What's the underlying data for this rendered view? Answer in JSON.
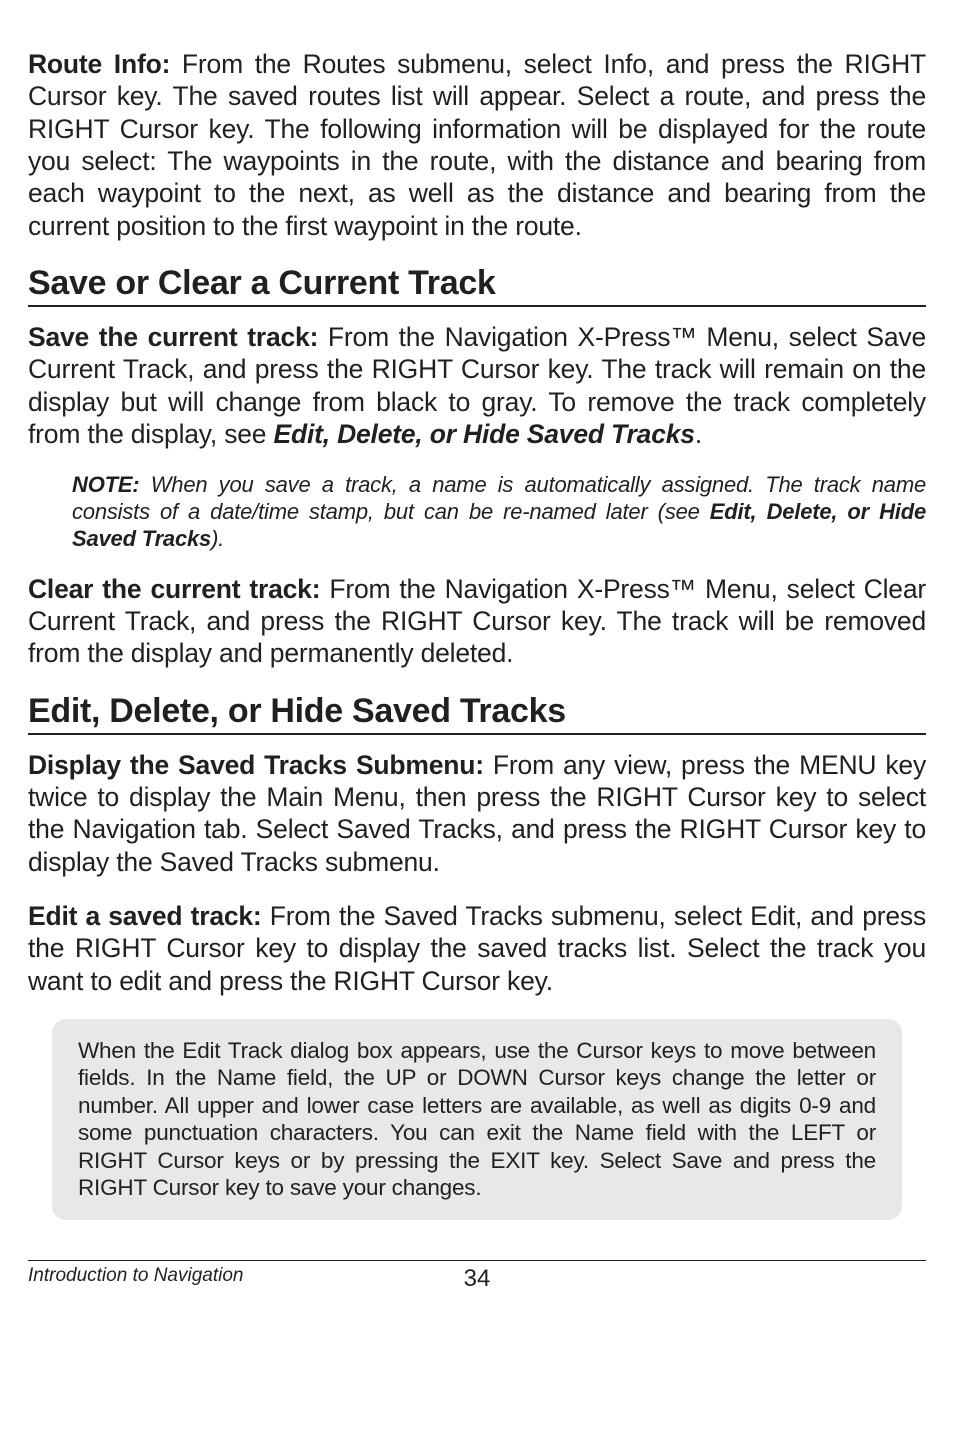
{
  "para1": {
    "lead": "Route Info:",
    "text": " From the Routes submenu, select Info, and press the RIGHT Cursor key. The saved routes list will appear. Select a route, and press the RIGHT Cursor key. The following information will be displayed for the route you select: The  waypoints in the route, with the distance and bearing from each waypoint to the next, as well as the distance and bearing from the current position to the first waypoint in the route."
  },
  "heading1": "Save or Clear a Current Track",
  "para2": {
    "lead": "Save the current track:",
    "text1": " From the Navigation X-Press™ Menu, select Save Current Track, and press the RIGHT Cursor key. The track will remain on the display but will change from black to gray. To remove the track completely from the display, see ",
    "ref": "Edit, Delete, or Hide Saved Tracks",
    "text2": "."
  },
  "note": {
    "label": "NOTE:",
    "text1": " When you save a track, a name is automatically assigned. The track name consists of a date/time stamp, but can be re-named later (see ",
    "ref": "Edit, Delete, or Hide Saved Tracks",
    "text2": ")."
  },
  "para3": {
    "lead": "Clear the current track:",
    "text": " From the Navigation X-Press™ Menu, select Clear Current Track, and press the RIGHT Cursor key. The track will be removed from the display and permanently deleted."
  },
  "heading2": "Edit, Delete, or Hide Saved Tracks",
  "para4": {
    "lead": "Display the Saved Tracks Submenu:",
    "text": " From any view, press the MENU key twice to display the Main Menu, then press the RIGHT Cursor key to select the Navigation tab. Select Saved Tracks, and press the RIGHT Cursor key to display the Saved Tracks submenu."
  },
  "para5": {
    "lead": "Edit a saved track:",
    "text": " From the Saved Tracks submenu, select Edit, and press the RIGHT Cursor key to display the saved tracks list. Select the track you want to edit and press the RIGHT Cursor key."
  },
  "callout": "When the Edit Track dialog box appears, use the Cursor keys to move between fields. In the Name field, the UP or DOWN Cursor keys change the letter or number. All upper and lower case letters are available, as well as digits 0-9 and some punctuation characters. You can exit the Name field with the LEFT or RIGHT Cursor keys or by pressing the EXIT key. Select Save and press the RIGHT Cursor key to save your changes.",
  "footer": {
    "section": "Introduction to Navigation",
    "page": "34"
  }
}
